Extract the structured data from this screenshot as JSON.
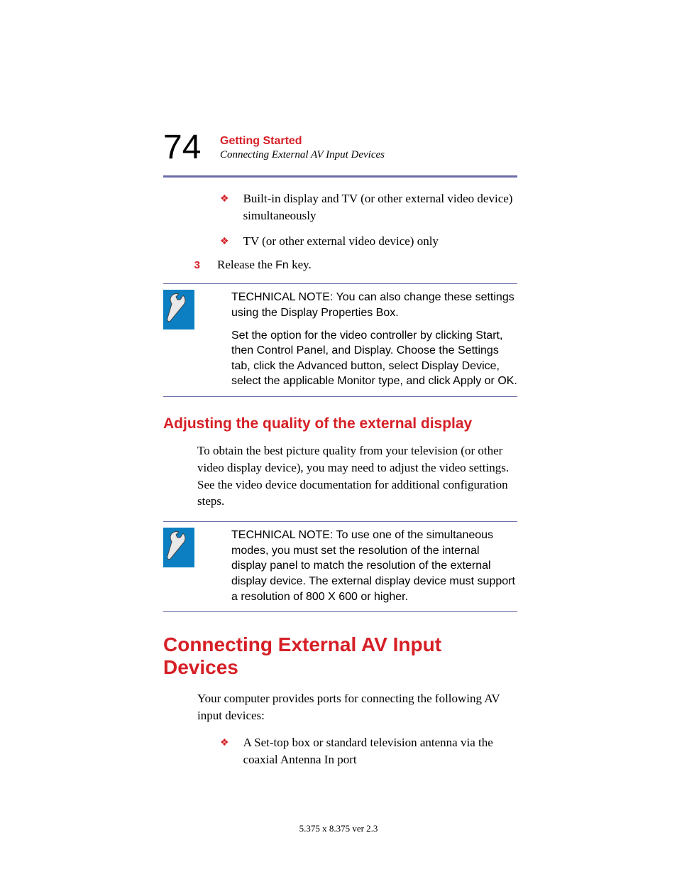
{
  "header": {
    "page_number": "74",
    "chapter": "Getting Started",
    "subtitle": "Connecting External AV Input Devices"
  },
  "bullets": {
    "b1": "Built-in display and TV (or other external video device) simultaneously",
    "b2": "TV (or other external video device) only"
  },
  "step3": {
    "num": "3",
    "prefix": "Release the ",
    "fn": "Fn",
    "suffix": " key."
  },
  "note1": {
    "p1": "TECHNICAL NOTE: You can also change these settings using the Display Properties Box.",
    "p2": "Set the option for the video controller by clicking Start, then Control Panel, and Display. Choose the Settings tab, click the Advanced button, select Display Device, select the applicable Monitor type, and click Apply or OK."
  },
  "heading_adjust": "Adjusting the quality of the external display",
  "para_adjust": "To obtain the best picture quality from your television (or other video display device), you may need to adjust the video settings. See the video device documentation for additional configuration steps.",
  "note2": {
    "p1": "TECHNICAL NOTE: To use one of the simultaneous modes, you must set the resolution of the internal display panel to match the resolution of the external display device. The external display device must support a resolution of 800 X 600 or higher."
  },
  "heading_connect": "Connecting External AV Input Devices",
  "para_connect": "Your computer provides ports for connecting the following AV input devices:",
  "bullets2": {
    "b1": "A Set-top box or standard television antenna via the coaxial Antenna In port"
  },
  "footer": "5.375 x 8.375 ver 2.3"
}
